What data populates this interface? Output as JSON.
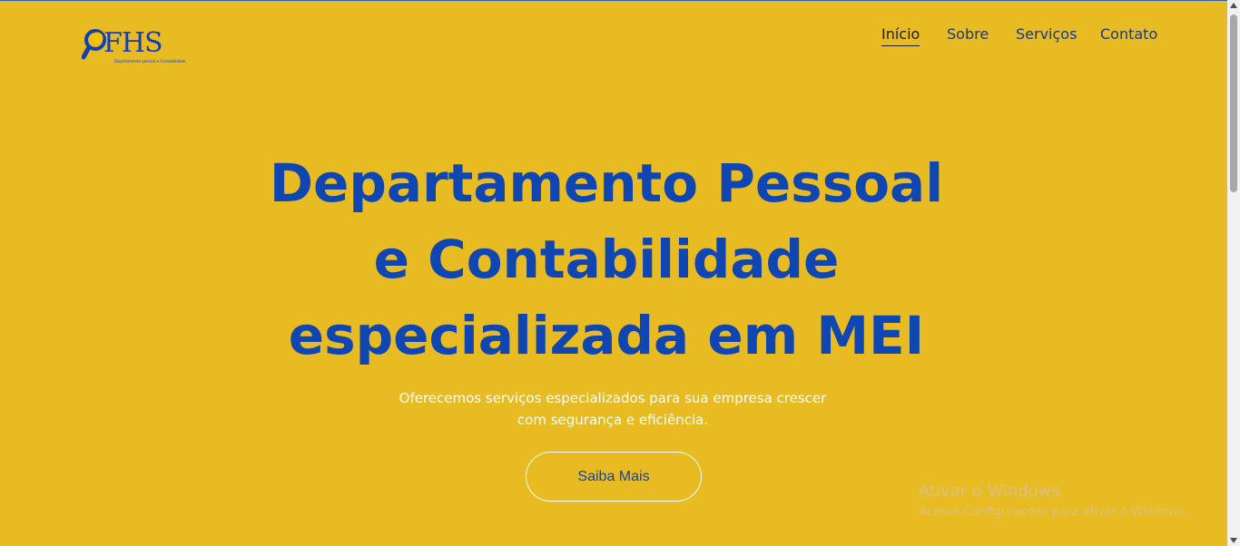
{
  "brand": {
    "name": "FHS",
    "tagline": "Departamento pessoal e Contabilidade"
  },
  "nav": {
    "items": [
      {
        "label": "Início",
        "active": true
      },
      {
        "label": "Sobre",
        "active": false
      },
      {
        "label": "Serviços",
        "active": false
      },
      {
        "label": "Contato",
        "active": false
      }
    ]
  },
  "hero": {
    "title_line1": "Departamento Pessoal",
    "title_line2": "e Contabilidade",
    "title_line3": "especializada em MEI",
    "subtitle_line1": "Oferecemos serviços especializados para sua empresa crescer",
    "subtitle_line2": "com segurança e eficiência.",
    "cta_label": "Saiba Mais"
  },
  "watermark": {
    "title": "Ativar o Windows",
    "subtitle": "Acesse Configurações para ativar o Windows."
  },
  "colors": {
    "background": "#E8BB22",
    "primary_blue": "#0F46B2",
    "white": "#FFFFFF"
  },
  "icons": {
    "logo": "magnifier-logo-icon"
  }
}
